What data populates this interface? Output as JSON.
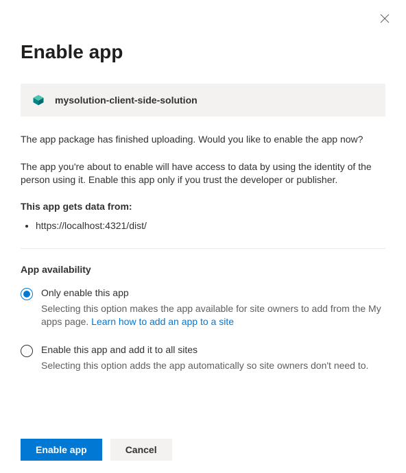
{
  "dialog": {
    "title": "Enable app",
    "package_name": "mysolution-client-side-solution",
    "description_1": "The app package has finished uploading. Would you like to enable the app now?",
    "description_2": "The app you're about to enable will have access to data by using the identity of the person using it. Enable this app only if you trust the developer or publisher.",
    "data_from_heading": "This app gets data from:",
    "data_sources": [
      "https://localhost:4321/dist/"
    ],
    "availability": {
      "heading": "App availability",
      "options": [
        {
          "label": "Only enable this app",
          "description_prefix": "Selecting this option makes the app available for site owners to add from the My apps page. ",
          "link_text": "Learn how to add an app to a site",
          "selected": true
        },
        {
          "label": "Enable this app and add it to all sites",
          "description": "Selecting this option adds the app automatically so site owners don't need to.",
          "selected": false
        }
      ]
    },
    "buttons": {
      "primary": "Enable app",
      "secondary": "Cancel"
    }
  },
  "colors": {
    "primary": "#0078d4",
    "teal": "#038387"
  }
}
